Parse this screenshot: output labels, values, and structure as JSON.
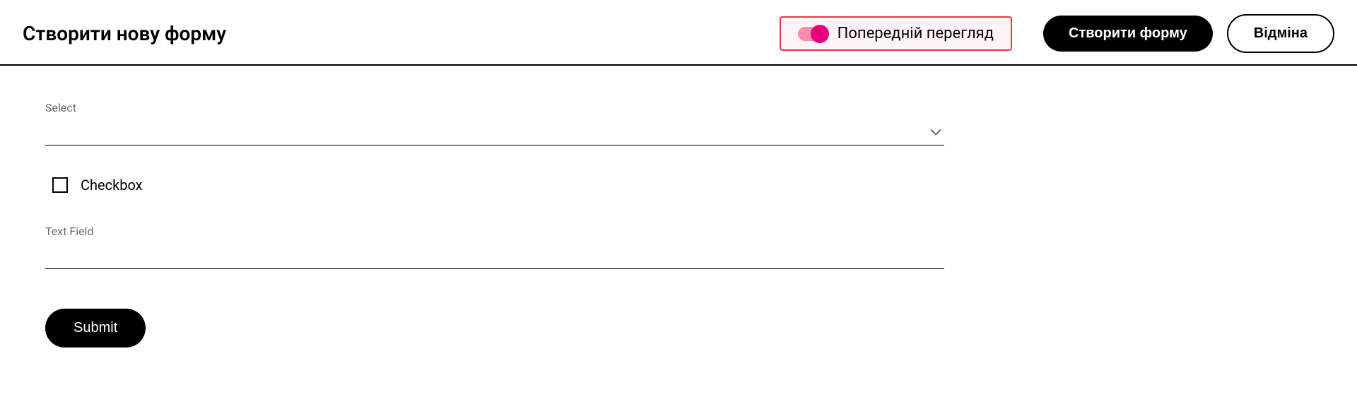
{
  "header": {
    "title": "Створити нову форму",
    "preview_label": "Попередній перегляд",
    "create_button": "Створити форму",
    "cancel_button": "Відміна"
  },
  "form": {
    "select_label": "Select",
    "checkbox_label": "Checkbox",
    "textfield_label": "Text Field",
    "submit_label": "Submit"
  }
}
